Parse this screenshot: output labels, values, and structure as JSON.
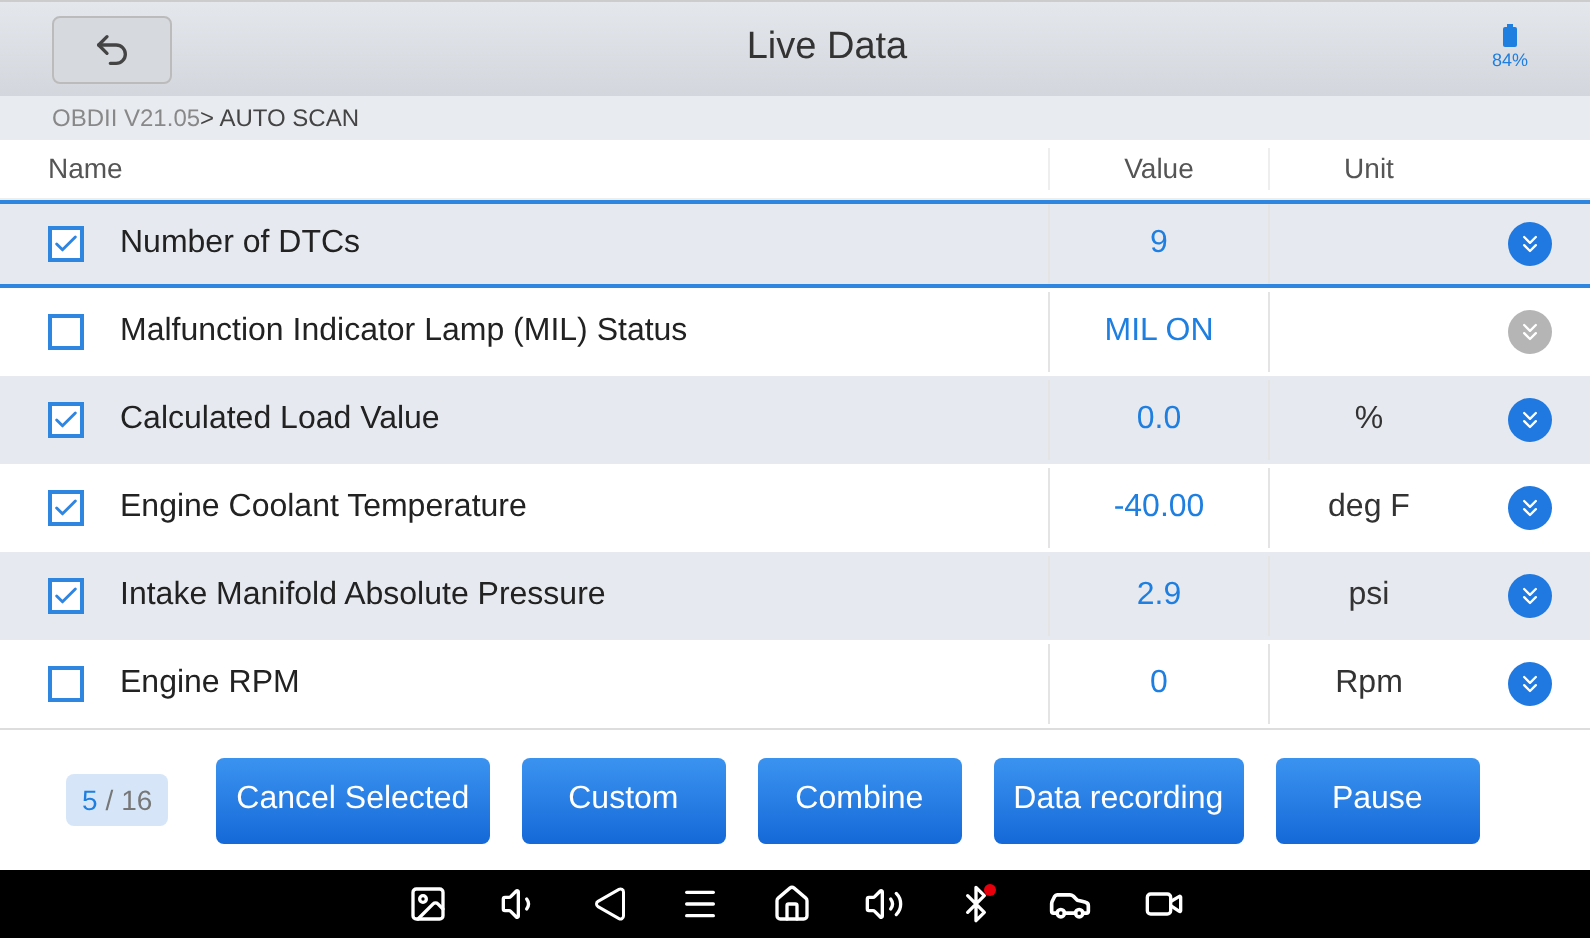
{
  "window": {
    "title": "Live Data",
    "battery": "84%"
  },
  "breadcrumb": {
    "path": "OBDII V21.05",
    "current": "> AUTO SCAN"
  },
  "table": {
    "columns": [
      "Name",
      "Value",
      "Unit"
    ],
    "rows": [
      {
        "name": "Number of DTCs",
        "value": "9",
        "unit": "",
        "checked": true,
        "selected": true,
        "expandable": true
      },
      {
        "name": "Malfunction Indicator Lamp (MIL) Status",
        "value": "MIL ON",
        "unit": "",
        "checked": false,
        "selected": false,
        "expandable": false
      },
      {
        "name": "Calculated Load Value",
        "value": "0.0",
        "unit": "%",
        "checked": true,
        "selected": false,
        "expandable": true
      },
      {
        "name": "Engine Coolant Temperature",
        "value": "-40.00",
        "unit": "deg F",
        "checked": true,
        "selected": false,
        "expandable": true
      },
      {
        "name": "Intake Manifold Absolute Pressure",
        "value": "2.9",
        "unit": "psi",
        "checked": true,
        "selected": false,
        "expandable": true
      },
      {
        "name": "Engine RPM",
        "value": "0",
        "unit": "Rpm",
        "checked": false,
        "selected": false,
        "expandable": true
      }
    ]
  },
  "footer": {
    "page_current": "5",
    "page_total": "/ 16",
    "buttons": [
      "Cancel Selected",
      "Custom",
      "Combine",
      "Data recording",
      "Pause"
    ]
  }
}
